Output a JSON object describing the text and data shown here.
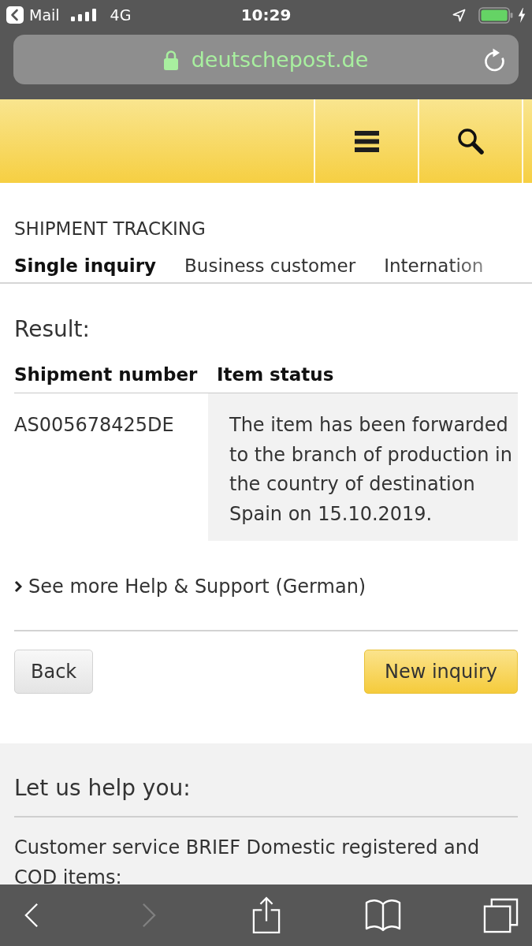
{
  "status_bar": {
    "back_label": "Mail",
    "network": "4G",
    "time": "10:29"
  },
  "address_bar": {
    "url": "deutschepost.de",
    "secure": true
  },
  "tracking": {
    "title": "SHIPMENT TRACKING",
    "tabs": [
      {
        "label": "Single inquiry",
        "selected": true
      },
      {
        "label": "Business customer",
        "selected": false
      },
      {
        "label": "Internation",
        "selected": false
      }
    ],
    "result_label": "Result:",
    "table": {
      "columns": [
        "Shipment number",
        "Item status"
      ],
      "rows": [
        [
          "AS005678425DE",
          "The item has been forwarded to the branch of production in the country of destination Spain on 15.10.2019."
        ]
      ]
    },
    "help_link": "See more Help & Support (German)",
    "buttons": [
      {
        "label": "Back",
        "kind": "secondary"
      },
      {
        "label": "New inquiry",
        "kind": "primary"
      }
    ]
  },
  "help_section": {
    "title": "Let us help you:",
    "text": "Customer service BRIEF Domestic registered and COD items:"
  },
  "toolbar": [
    {
      "kind": "back",
      "disabled": false
    },
    {
      "kind": "forward",
      "disabled": true
    },
    {
      "kind": "share",
      "disabled": false
    },
    {
      "kind": "bookmarks",
      "disabled": false
    },
    {
      "kind": "tabs",
      "disabled": false
    }
  ]
}
